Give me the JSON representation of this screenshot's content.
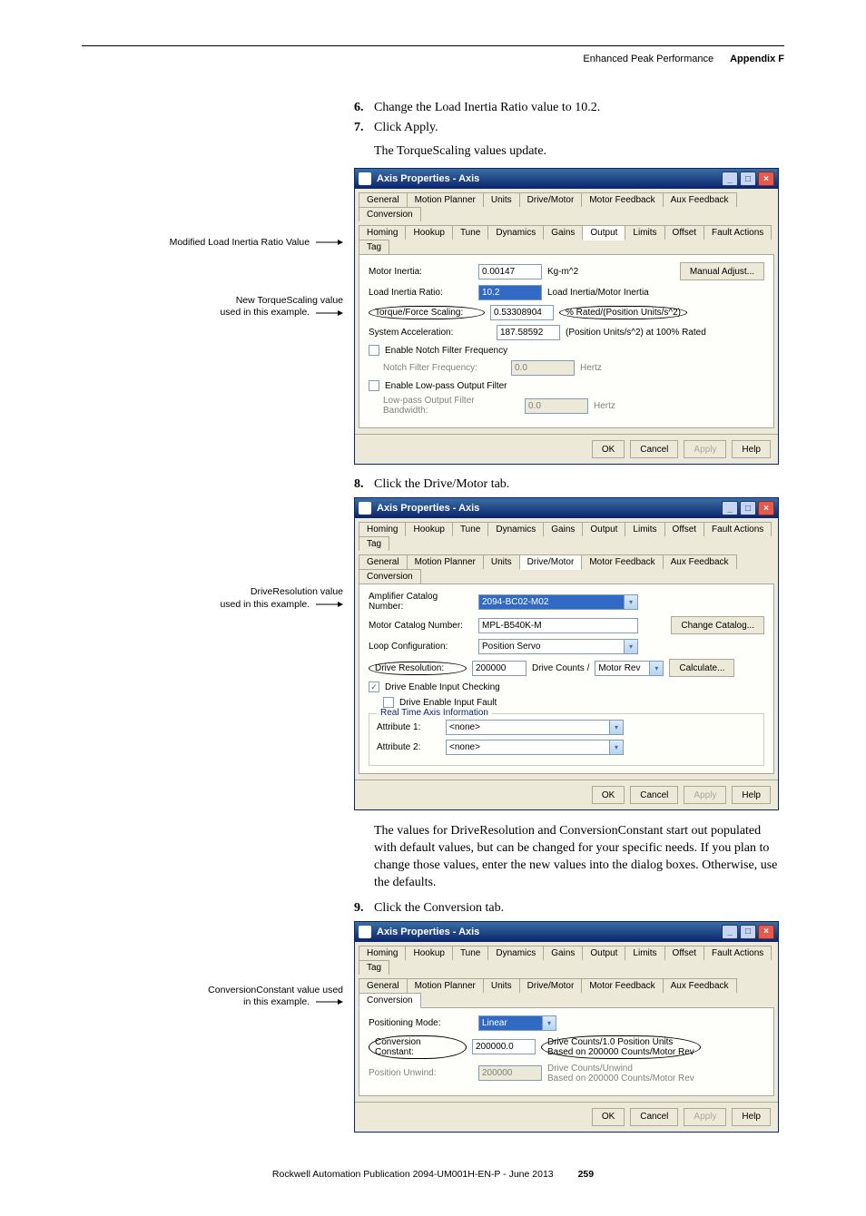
{
  "header": {
    "title": "Enhanced Peak Performance",
    "section": "Appendix F"
  },
  "steps": {
    "s6": "Change the Load Inertia Ratio value to 10.2.",
    "s7": "Click Apply.",
    "s7_after": "The TorqueScaling values update.",
    "s8": "Click the Drive/Motor tab.",
    "s8_after": "The values for DriveResolution and ConversionConstant start out populated with default values, but can be changed for your specific needs. If you plan to change those values, enter the new values into the dialog boxes. Otherwise, use the defaults.",
    "s9": "Click the Conversion tab."
  },
  "callouts": {
    "win1_a": "Modified Load Inertia Ratio Value",
    "win1_b_l1": "New TorqueScaling value",
    "win1_b_l2": "used in this example.",
    "win2_a_l1": "DriveResolution value",
    "win2_a_l2": "used in this example.",
    "win3_a_l1": "ConversionConstant value used",
    "win3_a_l2": "in this example."
  },
  "win_title": "Axis Properties - Axis",
  "tabs_all": {
    "General": "General",
    "MotionPlanner": "Motion Planner",
    "Units": "Units",
    "DriveMotor": "Drive/Motor",
    "MotorFeedback": "Motor Feedback",
    "AuxFeedback": "Aux Feedback",
    "Conversion": "Conversion",
    "Homing": "Homing",
    "Hookup": "Hookup",
    "Tune": "Tune",
    "Dynamics": "Dynamics",
    "Gains": "Gains",
    "Output": "Output",
    "Limits": "Limits",
    "Offset": "Offset",
    "FaultActions": "Fault Actions",
    "Tag": "Tag"
  },
  "win1": {
    "motor_inertia_label": "Motor Inertia:",
    "motor_inertia_value": "0.00147",
    "motor_inertia_units": "Kg-m^2",
    "load_inertia_label": "Load Inertia Ratio:",
    "load_inertia_value": "10.2",
    "load_inertia_units": "Load Inertia/Motor Inertia",
    "torque_label": "Torque/Force Scaling:",
    "torque_value": "0.53308904",
    "torque_units": "% Rated/(Position Units/s^2)",
    "sys_accel_label": "System Acceleration:",
    "sys_accel_value": "187.58592",
    "sys_accel_units": "(Position Units/s^2) at 100% Rated",
    "notch_chk": "Enable Notch Filter Frequency",
    "notch_freq_label": "Notch Filter Frequency:",
    "notch_freq_value": "0.0",
    "notch_freq_units": "Hertz",
    "lp_chk": "Enable Low-pass Output Filter",
    "lp_bw_label": "Low-pass Output Filter Bandwidth:",
    "lp_bw_value": "0.0",
    "lp_bw_units": "Hertz",
    "manual_adjust": "Manual Adjust..."
  },
  "win2": {
    "amp_label": "Amplifier Catalog Number:",
    "amp_value": "2094-BC02-M02",
    "motor_label": "Motor Catalog Number:",
    "motor_value": "MPL-B540K-M",
    "loop_label": "Loop Configuration:",
    "loop_value": "Position Servo",
    "dres_label": "Drive Resolution:",
    "dres_value": "200000",
    "dres_units1": "Drive Counts /",
    "dres_units2": "Motor Rev",
    "chk1": "Drive Enable Input Checking",
    "chk2": "Drive Enable Input Fault",
    "legend": "Real Time Axis Information",
    "attr1": "Attribute 1:",
    "attr2": "Attribute 2:",
    "none": "<none>",
    "change_catalog": "Change Catalog...",
    "calculate": "Calculate..."
  },
  "win3": {
    "pos_mode_label": "Positioning Mode:",
    "pos_mode_value": "Linear",
    "cc_label": "Conversion Constant:",
    "cc_value": "200000.0",
    "cc_units_l1": "Drive Counts/1.0 Position Units",
    "cc_units_l2": "Based on 200000 Counts/Motor Rev",
    "pu_label": "Position Unwind:",
    "pu_value": "200000",
    "pu_units_l1": "Drive Counts/Unwind",
    "pu_units_l2": "Based on 200000 Counts/Motor Rev"
  },
  "buttons": {
    "ok": "OK",
    "cancel": "Cancel",
    "apply": "Apply",
    "help": "Help"
  },
  "footer": {
    "pub": "Rockwell Automation Publication 2094-UM001H-EN-P - June 2013",
    "page": "259"
  }
}
